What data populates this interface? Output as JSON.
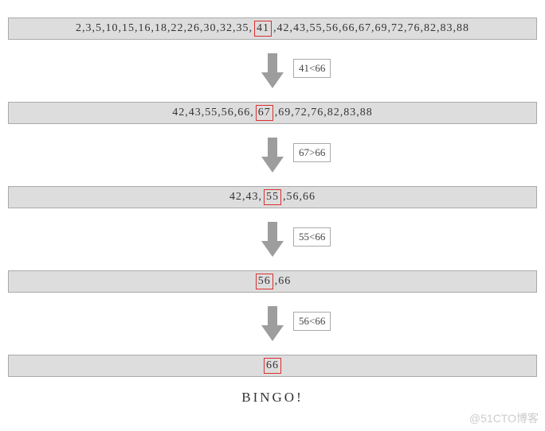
{
  "chart_data": {
    "type": "table",
    "title": "Binary search trace for target 66 in a sorted list",
    "target": 66,
    "rows": [
      {
        "values": [
          2,
          3,
          5,
          10,
          15,
          16,
          18,
          22,
          26,
          30,
          32,
          35,
          41,
          42,
          43,
          55,
          56,
          66,
          67,
          69,
          72,
          76,
          82,
          83,
          88
        ],
        "boxed_index": 12
      },
      {
        "values": [
          42,
          43,
          55,
          56,
          66,
          67,
          69,
          72,
          76,
          82,
          83,
          88
        ],
        "boxed_index": 5
      },
      {
        "values": [
          42,
          43,
          55,
          56,
          66
        ],
        "boxed_index": 2
      },
      {
        "values": [
          56,
          66
        ],
        "boxed_index": 0
      },
      {
        "values": [
          66
        ],
        "boxed_index": 0
      }
    ],
    "comparisons": [
      "41<66",
      "67>66",
      "55<66",
      "56<66"
    ],
    "result": "BINGO!"
  },
  "row0": {
    "pre": "2,3,5,10,15,16,18,22,26,30,32,35,",
    "mid": "41",
    "post": ",42,43,55,56,66,67,69,72,76,82,83,88"
  },
  "row1": {
    "pre": "42,43,55,56,66,",
    "mid": "67",
    "post": ",69,72,76,82,83,88"
  },
  "row2": {
    "pre": "42,43,",
    "mid": "55",
    "post": ",56,66"
  },
  "row3": {
    "pre": "",
    "mid": "56",
    "post": ",66"
  },
  "row4": {
    "pre": "",
    "mid": "66",
    "post": ""
  },
  "cmp": {
    "c0": "41<66",
    "c1": "67>66",
    "c2": "55<66",
    "c3": "56<66"
  },
  "bingo": "BINGO!",
  "watermark": "@51CTO博客",
  "compare_pos": {
    "c0": "left:358px;top:24px;",
    "c1": "left:358px;top:24px;",
    "c2": "left:358px;top:24px;",
    "c3": "left:358px;top:24px;"
  }
}
